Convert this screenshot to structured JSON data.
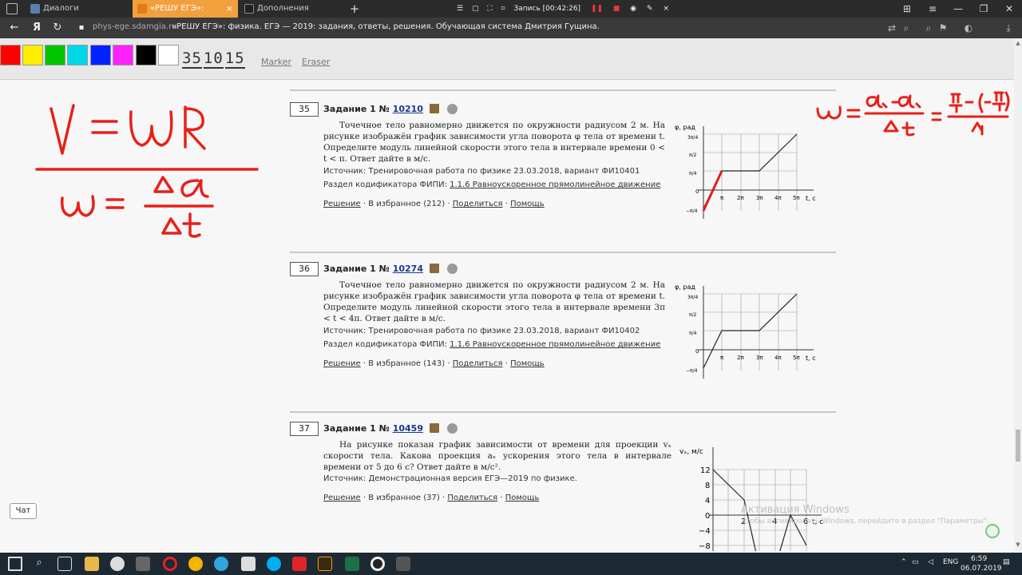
{
  "browser": {
    "tabs": [
      {
        "label": "Диалоги",
        "active": false
      },
      {
        "label": "«РЕШУ ЕГЭ»: физика. ЕГ",
        "active": true
      },
      {
        "label": "Дополнения",
        "active": false
      }
    ],
    "new_tab": "+",
    "recording": "Запись [00:42:26]",
    "url": "phys-ege.sdamgia.ru",
    "page_title": "«РЕШУ ЕГЭ»: физика. ЕГЭ — 2019: задания, ответы, решения. Обучающая система Дмитрия Гущина."
  },
  "drawing_toolbar": {
    "colors": [
      "#ff0000",
      "#ffee00",
      "#00c400",
      "#00d8e8",
      "#0022ff",
      "#ff22ff",
      "#000000",
      "#ffffff"
    ],
    "timer": [
      "35",
      "10",
      "15"
    ],
    "marker": "Marker",
    "eraser": "Eraser"
  },
  "tasks": [
    {
      "num": "35",
      "head": "Задание 1 №",
      "id": "10210",
      "text": "Точечное тело равномерно движется по окружности радиусом 2 м. На рисунке изображён график зависимости угла поворота φ тела от времени t. Определите модуль линейной скорости этого тела в интервале времени 0 < t < π. Ответ дайте в м/с.",
      "source": "Источник: Тренировочная работа по физике 23.03.2018, вариант ФИ10401",
      "section_prefix": "Раздел кодификатора ФИПИ:",
      "section": "1.1.6 Равноускоренное прямолинейное движение",
      "actions": [
        "Решение",
        "В избранное (212)",
        "Поделиться",
        "Помощь"
      ]
    },
    {
      "num": "36",
      "head": "Задание 1 №",
      "id": "10274",
      "text": "Точечное тело равномерно движется по окружности радиусом 2 м. На рисунке изображён график зависимости угла поворота φ тела от времени t. Определите модуль линейной скорости этого тела в интервале времени 3π < t < 4π. Ответ дайте в м/с.",
      "source": "Источник: Тренировочная работа по физике 23.03.2018, вариант ФИ10402",
      "section_prefix": "Раздел кодификатора ФИПИ:",
      "section": "1.1.6 Равноускоренное прямолинейное движение",
      "actions": [
        "Решение",
        "В избранное (143)",
        "Поделиться",
        "Помощь"
      ]
    },
    {
      "num": "37",
      "head": "Задание 1 №",
      "id": "10459",
      "text": "На рисунке показан график зависимости от времени для проекции vₓ скорости тела. Какова проекция aₓ ускорения этого тела в интервале времени от 5 до 6 с? Ответ дайте в м/с².",
      "source": "Источник: Демонстрационная версия ЕГЭ—2019 по физике.",
      "actions": [
        "Решение",
        "В избранное (37)",
        "Поделиться",
        "Помощь"
      ]
    }
  ],
  "graph_phi": {
    "ylabel": "φ, рад",
    "xlabel": "t, c",
    "yticks": [
      "3π/4",
      "π/2",
      "π/4",
      "0",
      "−π/4"
    ],
    "xticks": [
      "π",
      "2π",
      "3π",
      "4π",
      "5π"
    ]
  },
  "graph_v": {
    "ylabel": "vₓ, м/с",
    "xlabel": "t, c",
    "yticks": [
      "12",
      "8",
      "4",
      "0",
      "−4",
      "−8"
    ],
    "xticks": [
      "2",
      "4",
      "6"
    ]
  },
  "annotations": {
    "left_formula_1": "V = ωR",
    "left_formula_2": "ω = Δα / Δt",
    "right_formula": "ω = (α₁ − α₀)/Δt = (π/4 − (−π/4))/Δt"
  },
  "chat": "Чат",
  "watermark": {
    "line1": "Активация Windows",
    "line2": "Чтобы активировать Windows, перейдите в раздел \"Параметры\"."
  },
  "taskbar": {
    "lang": "ENG",
    "time": "6:59",
    "date": "06.07.2019"
  }
}
